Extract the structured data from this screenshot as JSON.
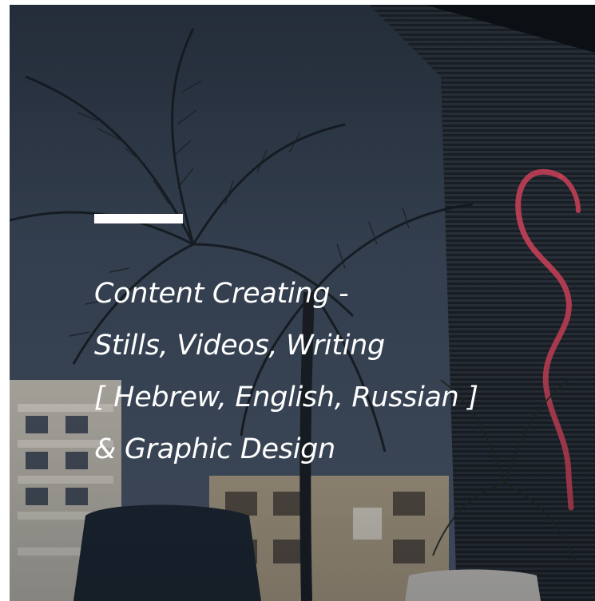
{
  "hero": {
    "background_description_icon": "photo-palm-trees-neon-flamingo",
    "accent_color": "#ffffff",
    "lines": [
      "Content Creating -",
      "Stills, Videos, Writing",
      "[ Hebrew, English, Russian ]",
      "& Graphic Design"
    ]
  }
}
